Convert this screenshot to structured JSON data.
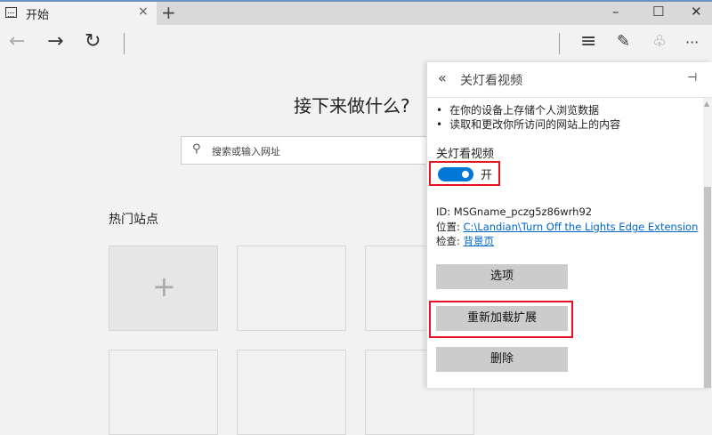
{
  "tab": {
    "title": "开始",
    "close": "×",
    "new": "+"
  },
  "window": {
    "minimize": "–",
    "maximize": "☐",
    "close": "✕"
  },
  "toolbar": {
    "back": "←",
    "forward": "→",
    "refresh": "↻",
    "hub": "≡",
    "note": "✎",
    "share": "♧",
    "more": "···"
  },
  "page": {
    "heading": "接下来做什么?",
    "search_placeholder": "搜索或输入网址",
    "top_sites": "热门站点",
    "add_tile": "+"
  },
  "panel": {
    "back": "«",
    "title": "关灯看视频",
    "pin": "⊣",
    "permissions": [
      "在你的设备上存储个人浏览数据",
      "读取和更改你所访问的网站上的内容"
    ],
    "toggle_label": "关灯看视频",
    "toggle_state": "开",
    "toggle_on": true,
    "id_line": "ID: MSGname_pczg5z86wrh92",
    "location_label": "位置: ",
    "location_value": "C:\\Landian\\Turn Off the Lights Edge Extension",
    "inspect_label": "检查: ",
    "inspect_value": "背景页",
    "options": "选项",
    "reload": "重新加载扩展",
    "remove": "删除"
  }
}
